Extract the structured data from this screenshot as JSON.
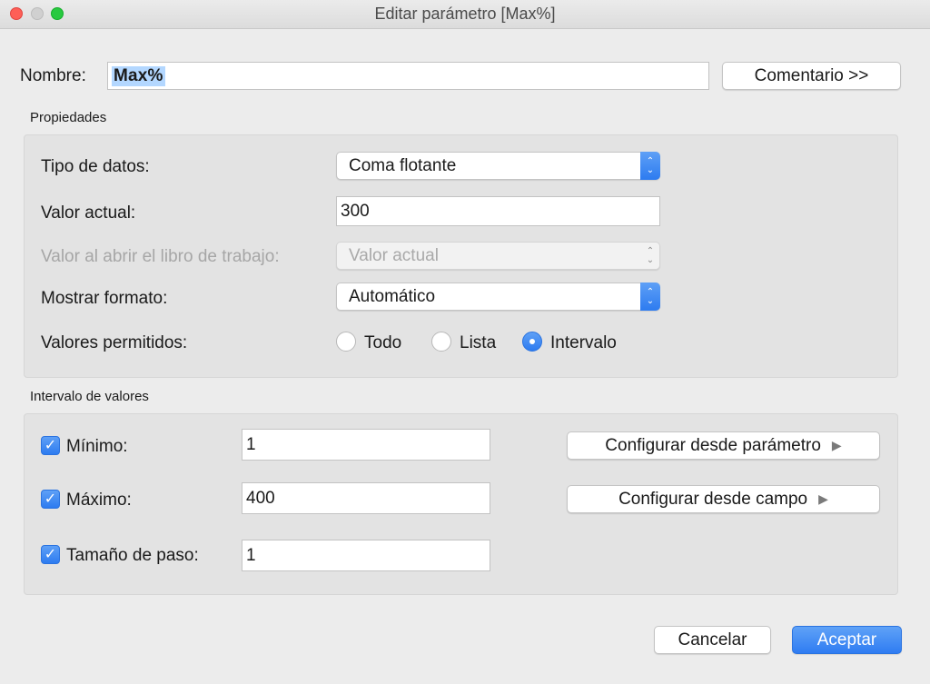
{
  "window": {
    "title": "Editar parámetro [Max%]"
  },
  "name": {
    "label": "Nombre:",
    "value": "Max%",
    "comment_button": "Comentario >>"
  },
  "properties": {
    "section_title": "Propiedades",
    "data_type": {
      "label": "Tipo de datos:",
      "value": "Coma flotante"
    },
    "current_value": {
      "label": "Valor actual:",
      "value": "300"
    },
    "open_value": {
      "label": "Valor al abrir el libro de trabajo:",
      "value": "Valor actual"
    },
    "display_format": {
      "label": "Mostrar formato:",
      "value": "Automático"
    },
    "allowed_values": {
      "label": "Valores permitidos:",
      "options": [
        "Todo",
        "Lista",
        "Intervalo"
      ],
      "selected": "Intervalo"
    }
  },
  "range": {
    "section_title": "Intervalo de valores",
    "minimum": {
      "label": "Mínimo:",
      "value": "1",
      "checked": true
    },
    "maximum": {
      "label": "Máximo:",
      "value": "400",
      "checked": true
    },
    "step": {
      "label": "Tamaño de paso:",
      "value": "1",
      "checked": true
    },
    "set_from_parameter": "Configurar desde parámetro",
    "set_from_field": "Configurar desde campo"
  },
  "footer": {
    "cancel": "Cancelar",
    "accept": "Aceptar"
  },
  "colors": {
    "accent": "#2f7cf2",
    "selection": "#b3d7ff",
    "panel": "#e3e3e3"
  }
}
